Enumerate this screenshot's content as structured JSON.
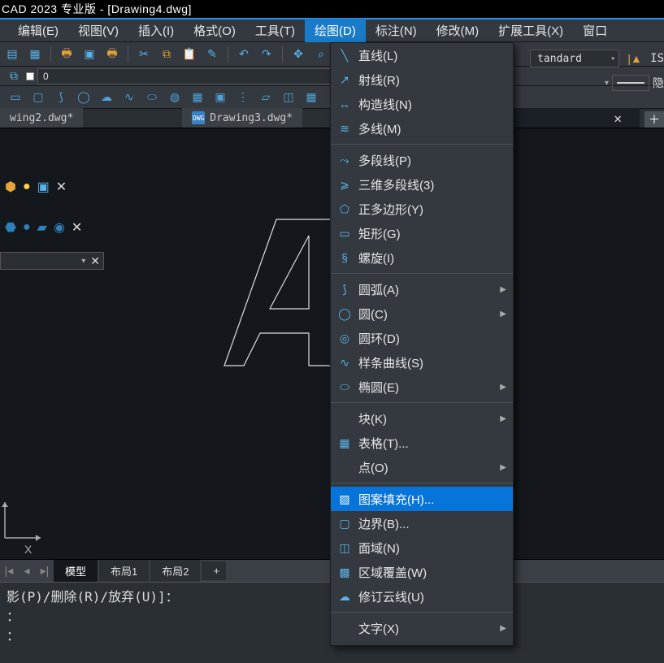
{
  "title": "CAD 2023 专业版 - [Drawing4.dwg]",
  "menu": {
    "edit": "编辑(E)",
    "view": "视图(V)",
    "insert": "插入(I)",
    "format": "格式(O)",
    "tools": "工具(T)",
    "draw": "绘图(D)",
    "dim": "标注(N)",
    "modify": "修改(M)",
    "ext": "扩展工具(X)",
    "window": "窗口"
  },
  "layer": {
    "current": "0"
  },
  "style": {
    "current": "tandard",
    "iso": "IS"
  },
  "tabs": {
    "t2": "wing2.dwg*",
    "t3": "Drawing3.dwg*"
  },
  "right_label": "隐",
  "bottom_tabs": {
    "model": "模型",
    "l1": "布局1",
    "l2": "布局2",
    "plus": "+"
  },
  "command": {
    "line1": "影(P)/删除(R)/放弃(U)]：",
    "line2": "：",
    "line3": "："
  },
  "ucs_x": "X",
  "dd": {
    "line": "直线(L)",
    "ray": "射线(R)",
    "xline": "构造线(N)",
    "mline": "多线(M)",
    "pline": "多段线(P)",
    "pline3d": "三维多段线(3)",
    "polygon": "正多边形(Y)",
    "rect": "矩形(G)",
    "spiral": "螺旋(I)",
    "arc": "圆弧(A)",
    "circle": "圆(C)",
    "donut": "圆环(D)",
    "spline": "样条曲线(S)",
    "ellipse": "椭圆(E)",
    "block": "块(K)",
    "table": "表格(T)...",
    "point": "点(O)",
    "hatch": "图案填充(H)...",
    "boundary": "边界(B)...",
    "region": "面域(N)",
    "wipeout": "区域覆盖(W)",
    "revcloud": "修订云线(U)",
    "text": "文字(X)"
  }
}
